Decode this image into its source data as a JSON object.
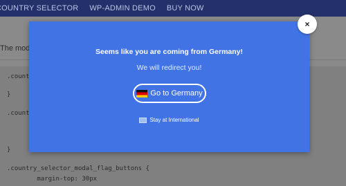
{
  "nav": {
    "items": [
      "Country Selector",
      "WP-Admin Demo",
      "Buy Now"
    ]
  },
  "page": {
    "intro_text": "The moda",
    "code_lines": [
      ".count",
      "}",
      ".count",
      "}",
      ".country_selector_modal_flag_buttons {",
      "        margin-top: 30px"
    ]
  },
  "modal": {
    "heading": "Seems like you are coming from Germany!",
    "subheading": "We will redirect you!",
    "primary_button_label": "Go to Germany",
    "primary_button_icon": "germany-flag-icon",
    "secondary_button_label": "Stay at International",
    "secondary_button_icon": "international-flag-icon",
    "close_label": "×",
    "background_color": "#4173e4"
  }
}
